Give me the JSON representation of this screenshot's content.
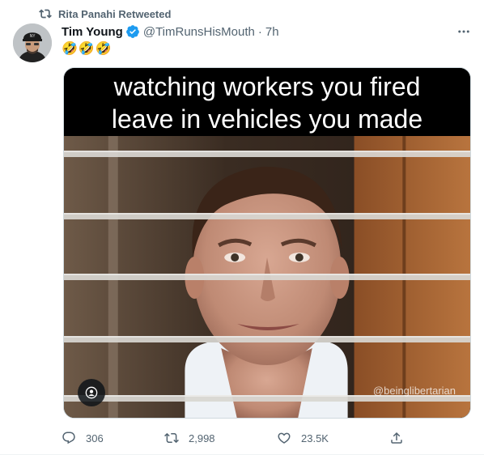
{
  "retweet_context": {
    "label": "Rita Panahi Retweeted",
    "icon": "retweet-icon"
  },
  "author": {
    "name": "Tim Young",
    "verified_icon": "verified-badge-icon",
    "handle": "@TimRunsHisMouth",
    "separator": "·",
    "time": "7h"
  },
  "tweet": {
    "text": "🤣🤣🤣"
  },
  "media": {
    "caption_line1": "watching workers you fired",
    "caption_line2": "leave in vehicles you made",
    "watermark": "@beinglibertarian",
    "tag_icon": "user-icon"
  },
  "actions": {
    "replies": "306",
    "retweets": "2,998",
    "likes": "23.5K",
    "share_icon": "share-icon"
  },
  "colors": {
    "secondary_text": "#536471",
    "verified": "#1d9bf0",
    "text": "#0f1419"
  }
}
